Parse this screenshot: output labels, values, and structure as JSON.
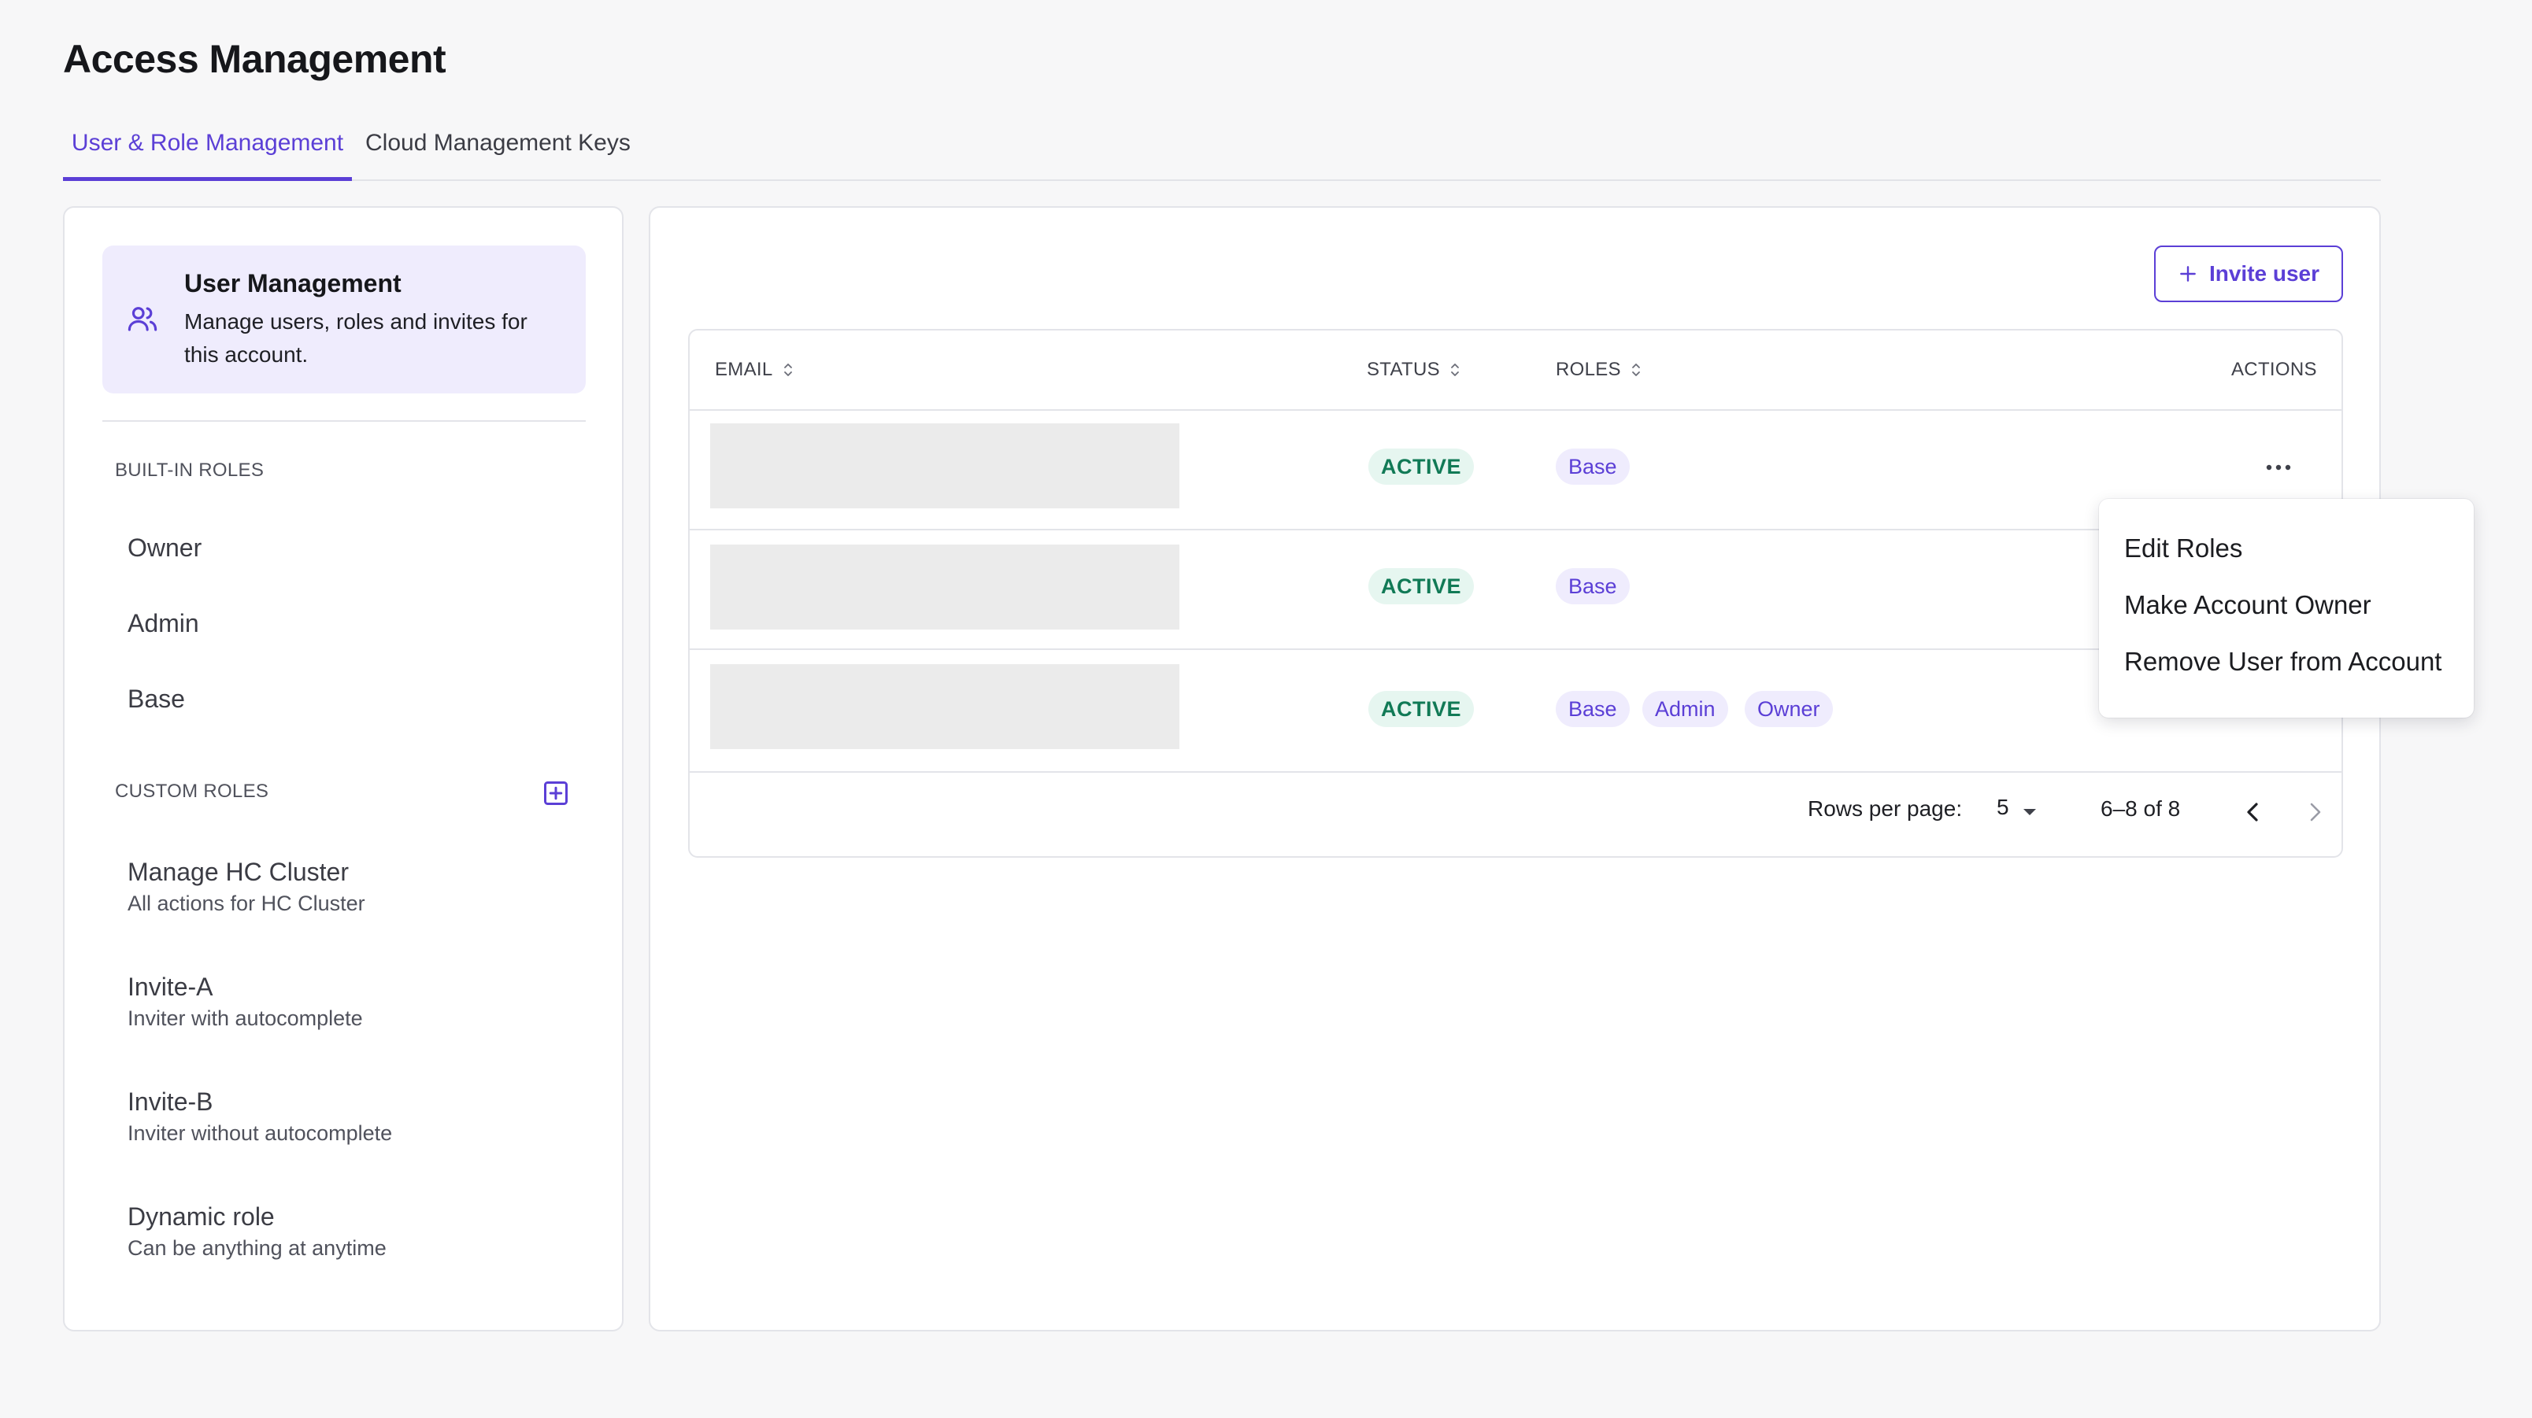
{
  "page": {
    "title": "Access Management"
  },
  "tabs": [
    {
      "label": "User & Role Management",
      "active": true
    },
    {
      "label": "Cloud Management Keys",
      "active": false
    }
  ],
  "sidebar": {
    "user_management": {
      "title": "User Management",
      "description": "Manage users, roles and invites for this account.",
      "icon": "users-icon"
    },
    "built_in_label": "BUILT-IN ROLES",
    "built_in_roles": [
      "Owner",
      "Admin",
      "Base"
    ],
    "custom_label": "CUSTOM ROLES",
    "custom_roles": [
      {
        "name": "Manage HC Cluster",
        "description": "All actions for HC Cluster"
      },
      {
        "name": "Invite-A",
        "description": "Inviter with autocomplete"
      },
      {
        "name": "Invite-B",
        "description": "Inviter without autocomplete"
      },
      {
        "name": "Dynamic role",
        "description": "Can be anything at anytime"
      }
    ]
  },
  "main": {
    "invite_label": "Invite user",
    "columns": {
      "email": "EMAIL",
      "status": "STATUS",
      "roles": "ROLES",
      "actions": "ACTIONS"
    },
    "rows": [
      {
        "email": "",
        "status": "ACTIVE",
        "roles": [
          "Base"
        ]
      },
      {
        "email": "",
        "status": "ACTIVE",
        "roles": [
          "Base"
        ]
      },
      {
        "email": "",
        "status": "ACTIVE",
        "roles": [
          "Base",
          "Admin",
          "Owner"
        ]
      }
    ],
    "pagination": {
      "rows_per_page_label": "Rows per page:",
      "rows_per_page": "5",
      "range": "6–8 of 8"
    }
  },
  "menu": {
    "items": [
      "Edit Roles",
      "Make Account Owner",
      "Remove User from Account"
    ]
  },
  "colors": {
    "accent": "#5b3fd6",
    "active_status_bg": "#e6f6f0",
    "active_status_text": "#117a56",
    "role_chip_bg": "#efecfd",
    "user_card_bg": "#efecfd"
  }
}
